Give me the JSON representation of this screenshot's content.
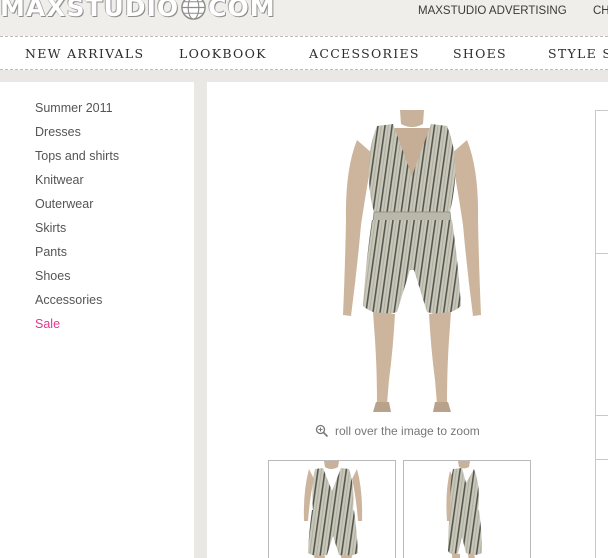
{
  "header": {
    "logo": {
      "left": "MAXSTUDIO",
      "right": "COM"
    },
    "links": {
      "advertising": "MAXSTUDIO ADVERTISING",
      "truncated": "CH"
    }
  },
  "nav": {
    "items": [
      "NEW ARRIVALS",
      "LOOKBOOK",
      "ACCESSORIES",
      "SHOES",
      "STYLE SH"
    ]
  },
  "sidebar": {
    "categories": [
      "Summer 2011",
      "Dresses",
      "Tops and shirts",
      "Knitwear",
      "Outerwear",
      "Skirts",
      "Pants",
      "Shoes",
      "Accessories",
      "Sale"
    ],
    "active_index": 9,
    "accent_color": "#e0388f"
  },
  "product": {
    "zoom_hint": "roll over the image to zoom",
    "icons": {
      "zoom": "magnifier-icon"
    },
    "thumbnail_count": 2
  },
  "colors": {
    "background": "#e9e8e4",
    "text": "#555555",
    "sale": "#e0388f"
  }
}
